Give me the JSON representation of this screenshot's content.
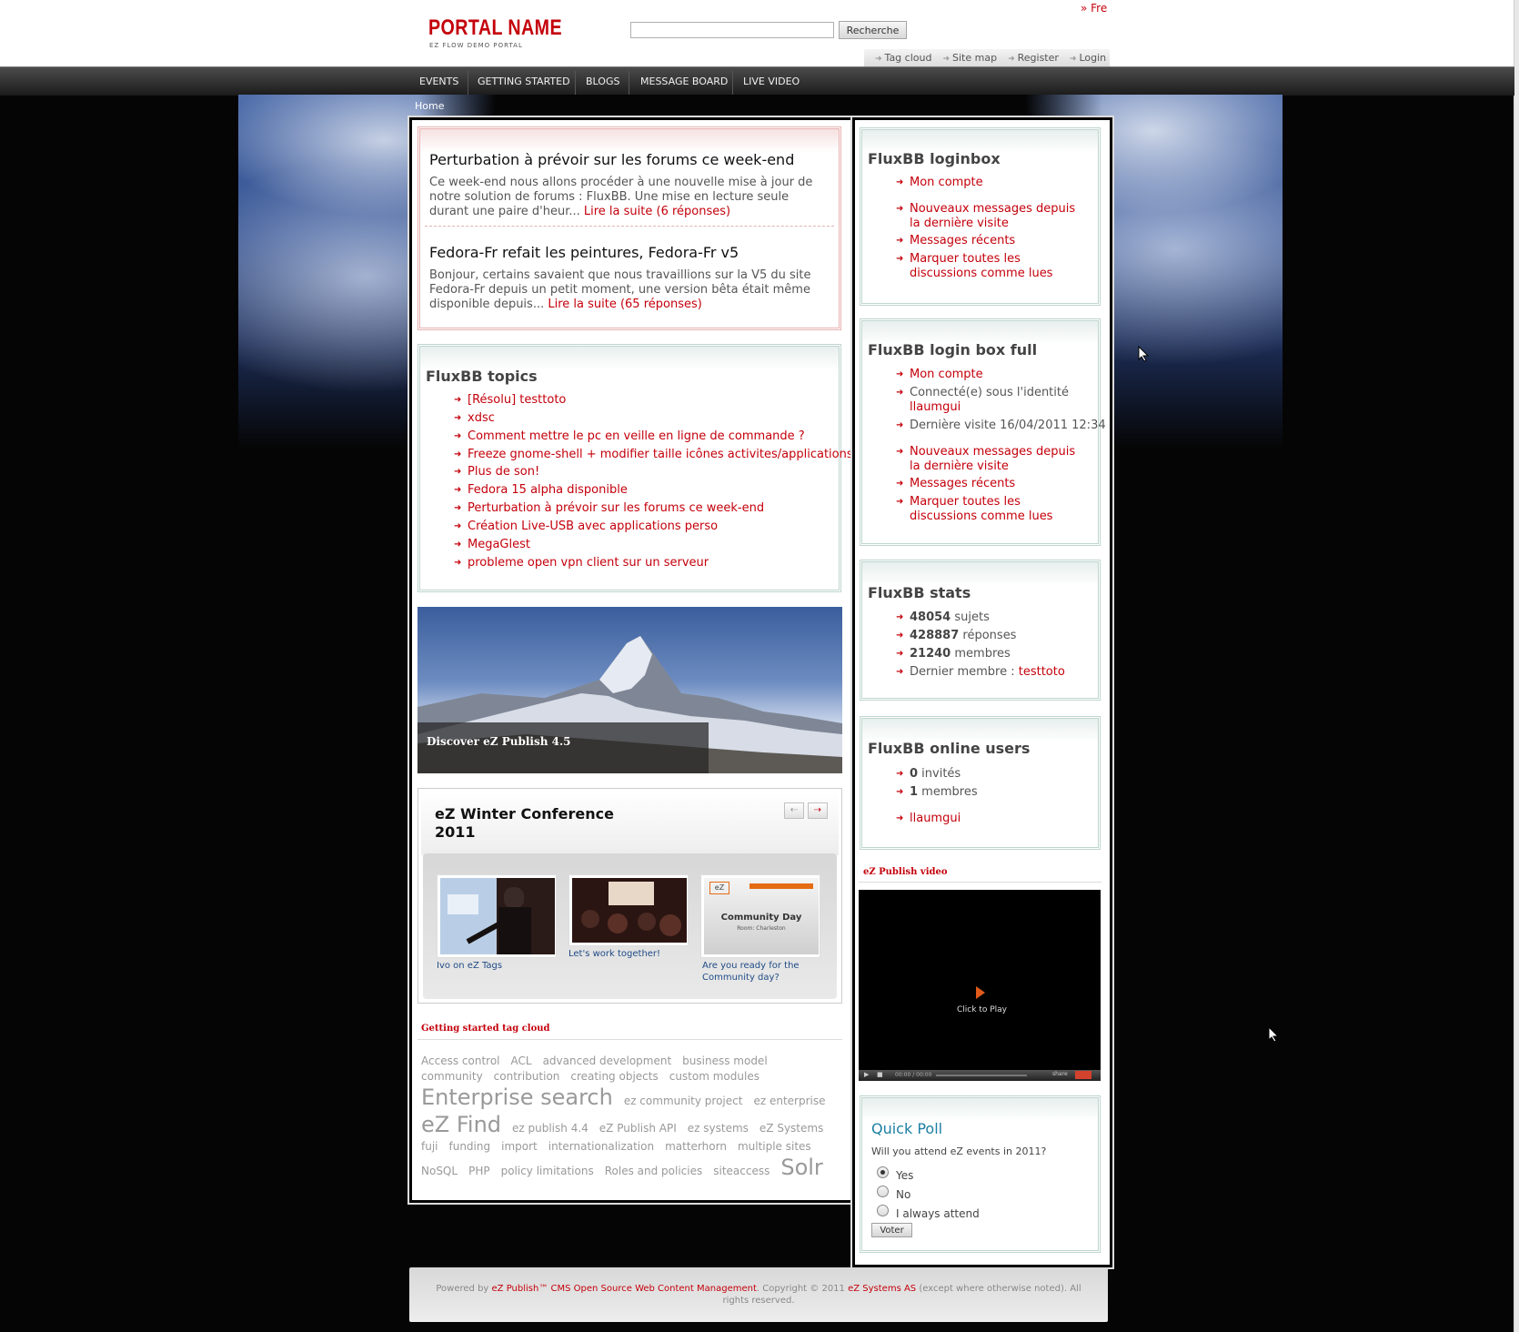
{
  "header": {
    "logo_title": "PORTAL NAME",
    "logo_subtitle": "EZ FLOW DEMO PORTAL",
    "language_link": "» Fre",
    "search_button": "Recherche",
    "search_value": "",
    "top_links": [
      "Tag cloud",
      "Site map",
      "Register",
      "Login"
    ]
  },
  "nav": {
    "items": [
      "EVENTS",
      "GETTING STARTED",
      "BLOGS",
      "MESSAGE BOARD",
      "LIVE VIDEO"
    ]
  },
  "breadcrumb": "Home",
  "articles": [
    {
      "title": "Perturbation à prévoir sur les forums ce week-end",
      "body": "Ce week-end nous allons procéder à une nouvelle mise à jour de notre solution de forums : FluxBB. Une mise en lecture seule durant une paire d'heur...",
      "link": "Lire la suite (6 réponses)"
    },
    {
      "title": "Fedora-Fr refait les peintures, Fedora-Fr v5",
      "body": "Bonjour, certains savaient que nous travaillions sur la V5 du site Fedora-Fr depuis un petit moment, une version bêta était même disponible depuis...",
      "link": "Lire la suite (65 réponses)"
    }
  ],
  "topics": {
    "title": "FluxBB topics",
    "items": [
      "[Résolu] testtoto",
      "xdsc",
      "Comment mettre le pc en veille en ligne de commande ?",
      "Freeze gnome-shell + modifier taille icônes activites/applications",
      "Plus de son!",
      "Fedora 15 alpha disponible",
      "Perturbation à prévoir sur les forums ce week-end",
      "Création Live-USB avec applications perso",
      "MegaGlest",
      "probleme open vpn client sur un serveur"
    ]
  },
  "hero": {
    "caption": "Discover eZ Publish 4.5"
  },
  "gallery": {
    "title": "eZ Winter Conference 2011",
    "prev_icon": "arrow-left-icon",
    "next_icon": "arrow-right-icon",
    "items": [
      {
        "caption": "Ivo on eZ Tags"
      },
      {
        "caption": "Let's work together!"
      },
      {
        "caption": "Are you ready for the Community day?",
        "slide_title": "Community Day",
        "slide_sub": "Room: Charleston",
        "slide_logo": "eZ"
      }
    ]
  },
  "tagcloud": {
    "title": "Getting started tag cloud",
    "tags": [
      {
        "t": "Access control",
        "s": 12
      },
      {
        "t": "ACL",
        "s": 12
      },
      {
        "t": "advanced development",
        "s": 12
      },
      {
        "t": "business model",
        "s": 12
      },
      {
        "t": "community",
        "s": 12
      },
      {
        "t": "contribution",
        "s": 12
      },
      {
        "t": "creating objects",
        "s": 12
      },
      {
        "t": "custom modules",
        "s": 12
      },
      {
        "t": "Enterprise search",
        "s": 24
      },
      {
        "t": "ez community project",
        "s": 12
      },
      {
        "t": "ez enterprise",
        "s": 12
      },
      {
        "t": "eZ Find",
        "s": 24
      },
      {
        "t": "ez publish 4.4",
        "s": 12
      },
      {
        "t": "eZ Publish API",
        "s": 12
      },
      {
        "t": "ez systems",
        "s": 12
      },
      {
        "t": "eZ Systems",
        "s": 12
      },
      {
        "t": "fuji",
        "s": 12
      },
      {
        "t": "funding",
        "s": 12
      },
      {
        "t": "import",
        "s": 12
      },
      {
        "t": "internationalization",
        "s": 12
      },
      {
        "t": "matterhorn",
        "s": 12
      },
      {
        "t": "multiple sites",
        "s": 12
      },
      {
        "t": "NoSQL",
        "s": 12
      },
      {
        "t": "PHP",
        "s": 12
      },
      {
        "t": "policy limitations",
        "s": 12
      },
      {
        "t": "Roles and policies",
        "s": 12
      },
      {
        "t": "siteaccess",
        "s": 12
      },
      {
        "t": "Solr",
        "s": 24
      }
    ]
  },
  "loginbox": {
    "title": "FluxBB loginbox",
    "items": [
      "Mon compte",
      "Nouveaux messages depuis la dernière visite",
      "Messages récents",
      "Marquer toutes les discussions comme lues"
    ]
  },
  "loginbox_full": {
    "title": "FluxBB login box full",
    "my_account": "Mon compte",
    "connected_label": "Connecté(e) sous l'identité",
    "user": "llaumgui",
    "last_visit": "Dernière visite 16/04/2011 12:34",
    "items": [
      "Nouveaux messages depuis la dernière visite",
      "Messages récents",
      "Marquer toutes les discussions comme lues"
    ]
  },
  "stats": {
    "title": "FluxBB stats",
    "topics_count": "48054",
    "topics_label": " sujets",
    "replies_count": "428887",
    "replies_label": " réponses",
    "members_count": "21240",
    "members_label": " membres",
    "last_member_label": "Dernier membre : ",
    "last_member": "testtoto"
  },
  "online": {
    "title": "FluxBB online users",
    "guests_count": "0",
    "guests_label": " invités",
    "members_count": "1",
    "members_label": " membres",
    "user": "llaumgui"
  },
  "video": {
    "title": "eZ Publish video",
    "play_text": "Click to Play",
    "time": "00:00 / 00:00",
    "share": "share"
  },
  "poll": {
    "title": "Quick Poll",
    "question": "Will you attend eZ events in 2011?",
    "options": [
      "Yes",
      "No",
      "I always attend"
    ],
    "selected": "Yes",
    "vote": "Voter"
  },
  "footer": {
    "powered": "Powered by ",
    "cms_link": "eZ Publish™ CMS Open Source Web Content Management",
    "copyright": ". Copyright © 2011 ",
    "company_link": "eZ Systems AS",
    "rights": " (except where otherwise noted). All rights reserved."
  },
  "colors": {
    "accent": "#c4000b",
    "link_blue": "#1f4a85",
    "poll_title": "#1c7fa3"
  }
}
